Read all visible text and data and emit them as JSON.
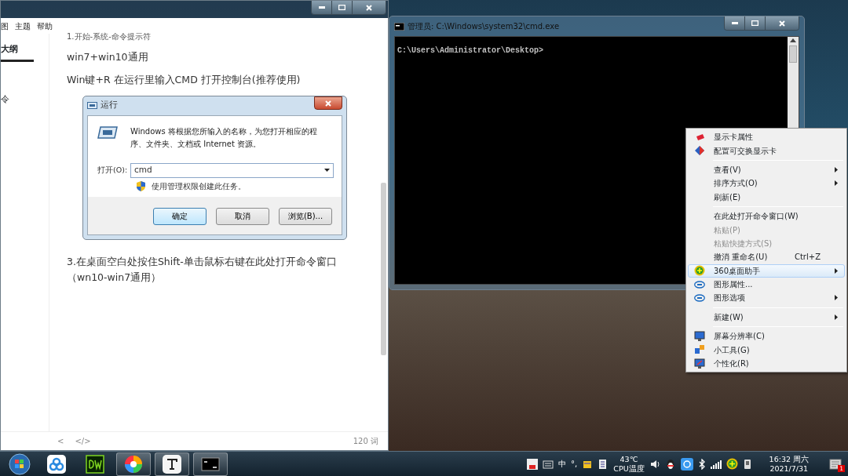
{
  "editor": {
    "menu": [
      "图",
      "主题",
      "帮助"
    ],
    "sidebar_tabs": [
      {
        "label": "大纲",
        "selected": true
      }
    ],
    "sidebar_items": [
      "令"
    ],
    "paragraphs": [
      "1.开始-系统-命令提示符",
      "win7+win10通用",
      "Win键+R 在运行里输入CMD 打开控制台(推荐使用)"
    ],
    "run_dialog": {
      "title": "运行",
      "description": "Windows 将根据您所输入的名称，为您打开相应的程序、文件夹、文档或 Internet 资源。",
      "open_label": "打开(O):",
      "value": "cmd",
      "admin_note": "使用管理权限创建此任务。",
      "buttons": [
        {
          "label": "确定",
          "default": true
        },
        {
          "label": "取消",
          "default": false
        },
        {
          "label": "浏览(B)...",
          "default": false
        }
      ]
    },
    "after_paragraphs": [
      "3.在桌面空白处按住Shift-单击鼠标右键在此处打开命令窗口（wn10-win7通用）"
    ],
    "footer": {
      "back_symbol": "<",
      "code_symbol": "</>",
      "word_count": "120 词"
    }
  },
  "cmd": {
    "title": "管理员: C:\\Windows\\system32\\cmd.exe",
    "prompt": "C:\\Users\\Administrator\\Desktop>"
  },
  "context_menu": {
    "items": [
      {
        "kind": "item",
        "label": "显示卡属性",
        "disabled": false,
        "selected": false,
        "submenu": false
      },
      {
        "kind": "item",
        "label": "配置可交换显示卡",
        "disabled": false,
        "selected": false,
        "submenu": false
      },
      {
        "kind": "separator"
      },
      {
        "kind": "item",
        "label": "查看(V)",
        "disabled": false,
        "selected": false,
        "submenu": true
      },
      {
        "kind": "item",
        "label": "排序方式(O)",
        "disabled": false,
        "selected": false,
        "submenu": true
      },
      {
        "kind": "item",
        "label": "刷新(E)",
        "disabled": false,
        "selected": false,
        "submenu": false
      },
      {
        "kind": "separator"
      },
      {
        "kind": "item",
        "label": "在此处打开命令窗口(W)",
        "disabled": false,
        "selected": false,
        "submenu": false
      },
      {
        "kind": "item",
        "label": "粘贴(P)",
        "disabled": true,
        "selected": false,
        "submenu": false
      },
      {
        "kind": "item",
        "label": "粘贴快捷方式(S)",
        "disabled": true,
        "selected": false,
        "submenu": false
      },
      {
        "kind": "item",
        "label": "撤消 重命名(U)",
        "shortcut": "Ctrl+Z",
        "disabled": false,
        "selected": false,
        "submenu": false
      },
      {
        "kind": "item",
        "label": "360桌面助手",
        "disabled": false,
        "selected": true,
        "submenu": true
      },
      {
        "kind": "item",
        "label": "图形属性...",
        "disabled": false,
        "selected": false,
        "submenu": false
      },
      {
        "kind": "item",
        "label": "图形选项",
        "disabled": false,
        "selected": false,
        "submenu": true
      },
      {
        "kind": "separator"
      },
      {
        "kind": "item",
        "label": "新建(W)",
        "disabled": false,
        "selected": false,
        "submenu": true
      },
      {
        "kind": "separator"
      },
      {
        "kind": "item",
        "label": "屏幕分辨率(C)",
        "disabled": false,
        "selected": false,
        "submenu": false
      },
      {
        "kind": "item",
        "label": "小工具(G)",
        "disabled": false,
        "selected": false,
        "submenu": false
      },
      {
        "kind": "item",
        "label": "个性化(R)",
        "disabled": false,
        "selected": false,
        "submenu": false
      }
    ]
  },
  "taskbar": {
    "apps": [
      {
        "running": false
      },
      {
        "running": false
      },
      {
        "running": true
      },
      {
        "running": true
      },
      {
        "running": true
      }
    ],
    "tray": {
      "ime_mode": "中",
      "punctuation": "°,",
      "temperature": "43℃",
      "temperature_label": "CPU温度",
      "time": "16:32 周六",
      "date": "2021/7/31",
      "notification_count": "1"
    }
  }
}
